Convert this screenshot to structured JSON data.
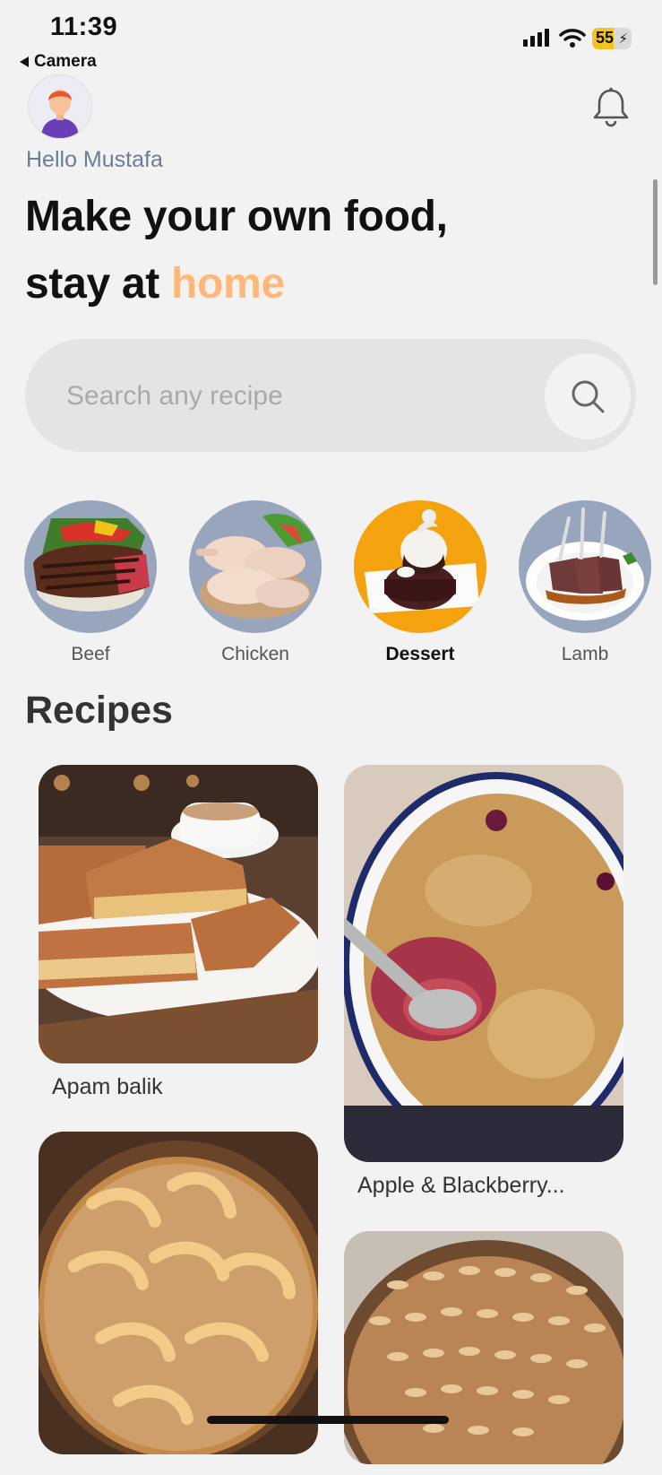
{
  "status_bar": {
    "time": "11:39",
    "back_label": "Camera",
    "battery": "55",
    "battery_color": "#f4c320"
  },
  "header": {
    "greeting": "Hello Mustafa",
    "headline_line1": "Make your own food,",
    "headline_line2_prefix": "stay at ",
    "headline_line2_accent": "home",
    "accent_color": "#ffb877",
    "avatar_icon": "user-avatar-icon",
    "notification_icon": "bell-icon"
  },
  "search": {
    "placeholder": "Search any recipe",
    "icon": "search-icon"
  },
  "categories": [
    {
      "label": "Beef",
      "active": false
    },
    {
      "label": "Chicken",
      "active": false
    },
    {
      "label": "Dessert",
      "active": true
    },
    {
      "label": "Lamb",
      "active": false
    }
  ],
  "category_active_color": "#f5a20f",
  "recipes": {
    "title": "Recipes",
    "items": [
      {
        "name": "Apam balik"
      },
      {
        "name": "Apple & Blackberry..."
      },
      {
        "name": ""
      },
      {
        "name": ""
      }
    ]
  }
}
